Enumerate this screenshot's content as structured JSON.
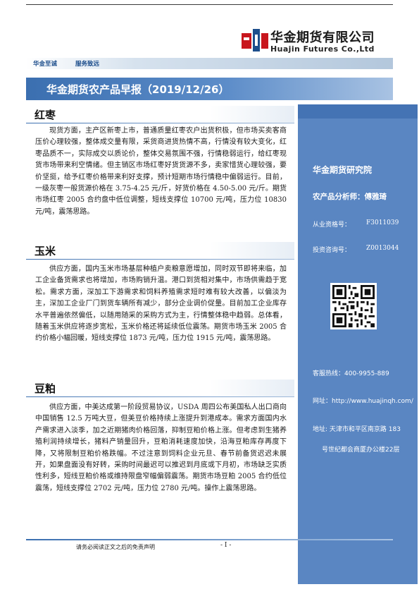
{
  "header": {
    "company_cn": "华金期货有限公司",
    "company_en": "Huajin Futures Co.,Ltd",
    "logo_icon": "huajin-logo-icon",
    "slogans": [
      "华金至诚",
      "服务致远"
    ],
    "report_title": "华金期货农产品早报（2019/12/26）"
  },
  "colors": {
    "brand_blue": "#3b6fb0",
    "sidebar_blue": "#5a86c2",
    "logo_red": "#c8161d",
    "logo_blue": "#1d4e8c"
  },
  "sections": [
    {
      "title": "红枣",
      "body": "现货方面，主产区新枣上市，普通质量红枣农户出货积极，但市场买卖客商压价心理较强，整体成交量有限，采货商进货热情不高，行情没有较大变化，红枣品质不一，实际成交以质论价，整体交易氛围不强，行情稳弱运行，给红枣现货市场带来利空情绪。但主销区市场红枣好货货源不多，卖家惜货心理较强，要价坚挺，给予红枣价格带来利好支撑，预计短期市场行情稳中偏弱运行。目前，一级灰枣一般货源价格在 3.75-4.25 元/斤，好货价格在 4.50-5.00 元/斤。期货市场红枣 2005 合约盘中低位调整，短线支撑位 10700 元/吨，压力位 10830 元/吨，震荡思路。"
    },
    {
      "title": "玉米",
      "body": "供应方面，国内玉米市场基层种植户卖粮意愿增加，同时双节即将来临，加工企业备货需求也将增加，市场购销升温。港口到货相对集中，市场供需趋于宽松。需求方面，深加工下游需求和饲料养殖需求短时难有较大改善，以偏淡为主，深加工企业厂门到货车辆所有减少，部分企业调价促量。目前加工企业库存水平普遍依然偏低，以随用随采的采购方式为主，行情整体稳中趋弱。总体看，随着玉米供应将逐步宽松，玉米价格还将延续低位震荡。期货市场玉米 2005 合约价格小幅回暖，短线支撑位 1873 元/吨，压力位 1915 元/吨，震荡思路。"
    },
    {
      "title": "豆粕",
      "body": "供应方面，中美达成第一阶段贸易协议，USDA 周四公布美国私人出口商向中国销售 12.5 万吨大豆，但美豆价格持续上涨提升到港成本。需求方面国内水产需求进入淡季，加之近期猪肉价格回落，抑制豆粕价格上涨。但考虑到生猪养殖利润持续增长，猪料产销量回升，豆粕消耗速度加快，沿海豆粕库存再度下降，又将限制豆粕价格跌幅。不过注意到饲料企业元旦、春节前备货迟迟未展开，如果盘面没有好转，采购时间最迟可以推迟到月底或下月初，市场缺乏实质性利多，短线豆粕价格或维持限盘窄幅偏弱震荡。期货市场豆粕 2005 合约低位震荡，短线支撑位 2702 元/吨，压力位 2780 元/吨。操作上震荡思路。"
    }
  ],
  "sidebar": {
    "institute": "华金期货研究院",
    "analyst": "农产品分析师：傅雅琦",
    "qualification_label": "从业资格号：",
    "qualification_value": "F3011039",
    "consult_label": "投资咨询号：",
    "consult_value": "Z0013044",
    "qr_icon": "qr-code-icon",
    "hotline": "客服热线：400-9955-889",
    "website": "网址：http://www.huajinqh.com/",
    "address_line1": "地址: 天津市和平区南京路 183",
    "address_line2": "号世纪都会商厦办公楼22层"
  },
  "footer": {
    "disclaimer": "请务必阅读正文之后的免责声明",
    "page": "- I -"
  }
}
